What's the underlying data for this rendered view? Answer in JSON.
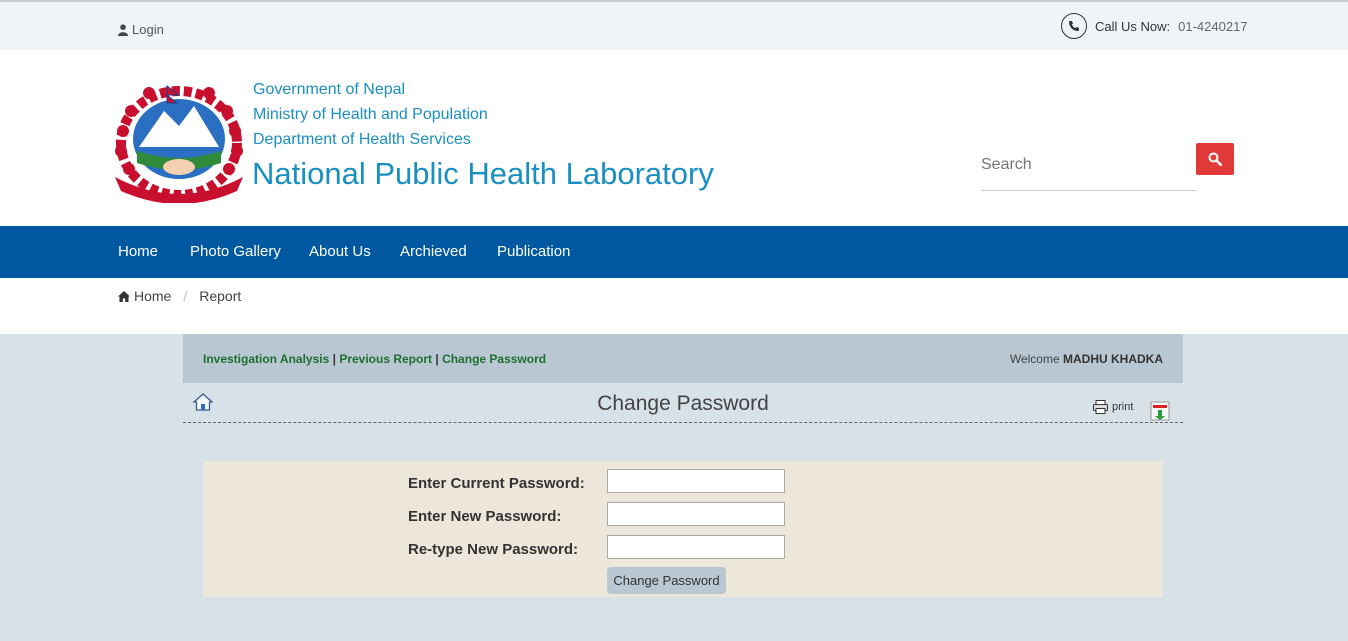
{
  "topbar": {
    "login_label": "Login",
    "call_label": "Call Us Now:",
    "call_number": "01-4240217"
  },
  "header": {
    "government": "Government of Nepal",
    "ministry": "Ministry of Health and Population",
    "department": "Department of Health Services",
    "org_name": "National Public Health Laboratory",
    "search_placeholder": "Search"
  },
  "nav": {
    "items": [
      "Home",
      "Photo Gallery",
      "About Us",
      "Archieved",
      "Publication"
    ]
  },
  "breadcrumb": {
    "home": "Home",
    "current": "Report"
  },
  "subnav": {
    "links": [
      "Investigation Analysis",
      "Previous Report",
      "Change Password"
    ],
    "separator": "|",
    "welcome_prefix": "Welcome",
    "username": "MADHU KHADKA"
  },
  "page": {
    "title": "Change Password",
    "print_label": "print"
  },
  "form": {
    "current_label": "Enter Current Password:",
    "new_label": "Enter New Password:",
    "retype_label": "Re-type New Password:",
    "current_value": "",
    "new_value": "",
    "retype_value": "",
    "submit_label": "Change Password"
  },
  "colors": {
    "brand_blue": "#0059a0",
    "title_blue": "#1a8fc2",
    "search_red": "#e03a3a",
    "link_green": "#1e6e30"
  }
}
